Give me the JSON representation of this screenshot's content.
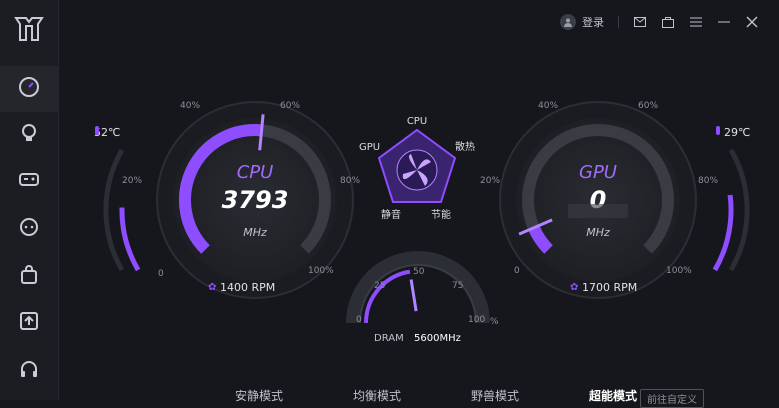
{
  "topbar": {
    "login_label": "登录",
    "icons": [
      "user-icon",
      "mail-icon",
      "box-icon",
      "menu-icon",
      "minimize-icon",
      "close-icon"
    ]
  },
  "sidebar": {
    "items": [
      {
        "name": "performance",
        "icon": "gauge-icon",
        "active": true
      },
      {
        "name": "lighting",
        "icon": "bulb-icon",
        "active": false
      },
      {
        "name": "games",
        "icon": "gamepad-icon",
        "active": false
      },
      {
        "name": "chat",
        "icon": "chat-icon",
        "active": false
      },
      {
        "name": "store",
        "icon": "bag-icon",
        "active": false
      },
      {
        "name": "update",
        "icon": "upload-icon",
        "active": false
      },
      {
        "name": "audio",
        "icon": "headset-icon",
        "active": false
      }
    ]
  },
  "cpu": {
    "title": "CPU",
    "value": "3793",
    "unit": "MHz",
    "temp": "52℃",
    "fan": "1400 RPM",
    "ticks": [
      "0",
      "20%",
      "40%",
      "60%",
      "80%",
      "100%"
    ],
    "load_fraction": 0.52,
    "temp_fraction": 0.52
  },
  "gpu": {
    "title": "GPU",
    "value": "0",
    "unit": "MHz",
    "temp": "29℃",
    "fan": "1700 RPM",
    "ticks": [
      "0",
      "20%",
      "40%",
      "60%",
      "80%",
      "100%"
    ],
    "load_fraction": 0.08,
    "temp_fraction": 0.62
  },
  "pentagon": {
    "labels": {
      "top": "CPU",
      "left": "GPU",
      "right": "散热",
      "bottom_left": "静音",
      "bottom_right": "节能"
    }
  },
  "dram": {
    "label": "DRAM",
    "value": "5600MHz",
    "ticks": [
      "0",
      "25",
      "50",
      "75",
      "100"
    ],
    "unit": "%",
    "level": 0.45
  },
  "modes": [
    {
      "label": "安静模式",
      "active": false
    },
    {
      "label": "均衡模式",
      "active": false
    },
    {
      "label": "野兽模式",
      "active": false
    },
    {
      "label": "超能模式",
      "active": true
    }
  ],
  "custom_label": "前往自定义",
  "colors": {
    "accent": "#8e4dff",
    "accent_light": "#b085ff",
    "bg": "#15171c"
  }
}
